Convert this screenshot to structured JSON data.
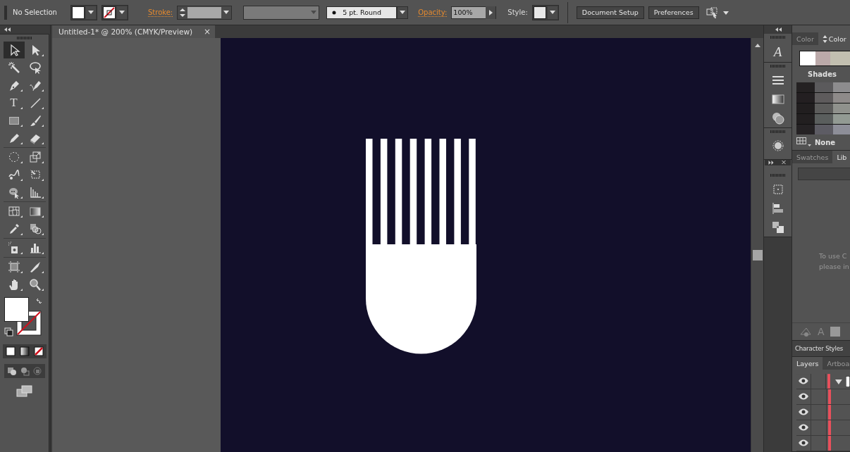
{
  "control_bar": {
    "selection": "No Selection",
    "stroke_label": "Stroke:",
    "brush": "5 pt. Round",
    "opacity_label": "Opacity:",
    "opacity": "100%",
    "style_label": "Style:",
    "buttons": [
      "Document Setup",
      "Preferences"
    ]
  },
  "document_tab": {
    "title": "Untitled-1* @ 200% (CMYK/Preview)",
    "close": "×"
  },
  "tools": [
    {
      "kind": "selection",
      "selected": true
    },
    {
      "kind": "direct",
      "selected": false
    },
    {
      "kind": "wand",
      "selected": false
    },
    {
      "kind": "lasso",
      "selected": false
    },
    {
      "kind": "pen",
      "selected": false
    },
    {
      "kind": "curvature",
      "selected": false
    },
    {
      "kind": "type",
      "glyph": "T",
      "selected": false
    },
    {
      "kind": "line",
      "selected": false
    },
    {
      "kind": "rectangle",
      "selected": false
    },
    {
      "kind": "brush",
      "selected": false
    },
    {
      "kind": "pencil",
      "selected": false
    },
    {
      "kind": "eraser",
      "selected": false
    },
    {
      "kind": "rotate",
      "selected": false
    },
    {
      "kind": "scale",
      "selected": false
    },
    {
      "kind": "warp",
      "selected": false
    },
    {
      "kind": "transform",
      "selected": false
    },
    {
      "kind": "builder",
      "selected": false
    },
    {
      "kind": "perspective",
      "selected": false
    },
    {
      "kind": "mesh",
      "selected": false
    },
    {
      "kind": "gradient",
      "selected": false
    },
    {
      "kind": "eyedropper",
      "selected": false
    },
    {
      "kind": "blend",
      "selected": false
    },
    {
      "kind": "sprayer",
      "selected": false
    },
    {
      "kind": "graph",
      "selected": false
    },
    {
      "kind": "artboard",
      "selected": false
    },
    {
      "kind": "slice",
      "selected": false
    },
    {
      "kind": "hand",
      "selected": false
    },
    {
      "kind": "zoom",
      "selected": false
    }
  ],
  "dock_glyph": "A",
  "panels": {
    "color_tabs": [
      {
        "label": "Color",
        "selected": false
      },
      {
        "label": "Color",
        "selected": true
      }
    ],
    "shades_title": "Shades",
    "shades": [
      {
        "cells": [
          {
            "color": "#242122"
          },
          {
            "color": "#5b5a5c"
          },
          {
            "color": "#8d8c8e"
          }
        ]
      },
      {
        "cells": [
          {
            "color": "#231f21"
          },
          {
            "color": "#5e5b5c"
          },
          {
            "color": "#8e8a89"
          }
        ]
      },
      {
        "cells": [
          {
            "color": "#211e1f"
          },
          {
            "color": "#5c5c5b"
          },
          {
            "color": "#8f918c"
          }
        ]
      },
      {
        "cells": [
          {
            "color": "#221f20"
          },
          {
            "color": "#5a5e5d"
          },
          {
            "color": "#929a93"
          }
        ]
      },
      {
        "cells": [
          {
            "color": "#252224"
          },
          {
            "color": "#5d5c64"
          },
          {
            "color": "#8d8e98"
          }
        ]
      }
    ],
    "none_label": "None",
    "library_tabs": [
      {
        "label": "Swatches",
        "selected": false
      },
      {
        "label": "Lib",
        "selected": true
      }
    ],
    "library_message": "To use C\nplease in",
    "library_glyph": "A",
    "character_styles": "Character Styles",
    "layer_tabs": [
      {
        "label": "Layers",
        "selected": true
      },
      {
        "label": "Artboa",
        "selected": false
      }
    ],
    "layers": [
      {
        "kind": "group"
      },
      {
        "kind": "item"
      },
      {
        "kind": "item"
      },
      {
        "kind": "item"
      },
      {
        "kind": "item"
      }
    ]
  }
}
